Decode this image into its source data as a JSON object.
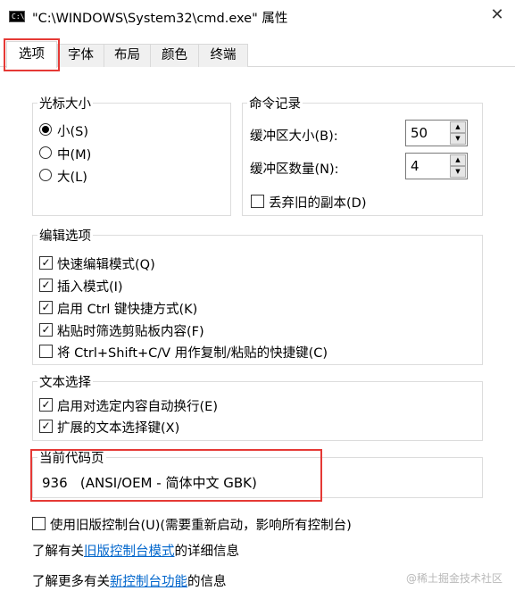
{
  "window": {
    "title": "\"C:\\WINDOWS\\System32\\cmd.exe\" 属性",
    "app_icon_text": "C:\\",
    "close_icon": "close-icon"
  },
  "tabs": [
    {
      "label": "选项",
      "active": true
    },
    {
      "label": "字体",
      "active": false
    },
    {
      "label": "布局",
      "active": false
    },
    {
      "label": "颜色",
      "active": false
    },
    {
      "label": "终端",
      "active": false
    }
  ],
  "cursor_size": {
    "title": "光标大小",
    "options": [
      {
        "label": "小(S)",
        "checked": true
      },
      {
        "label": "中(M)",
        "checked": false
      },
      {
        "label": "大(L)",
        "checked": false
      }
    ]
  },
  "command_history": {
    "title": "命令记录",
    "buffer_size_label": "缓冲区大小(B):",
    "buffer_size_value": "50",
    "buffer_count_label": "缓冲区数量(N):",
    "buffer_count_value": "4",
    "discard_label": "丢弃旧的副本(D)",
    "discard_checked": false
  },
  "edit_options": {
    "title": "编辑选项",
    "items": [
      {
        "label": "快速编辑模式(Q)",
        "checked": true
      },
      {
        "label": "插入模式(I)",
        "checked": true
      },
      {
        "label": "启用 Ctrl 键快捷方式(K)",
        "checked": true
      },
      {
        "label": "粘贴时筛选剪贴板内容(F)",
        "checked": true
      },
      {
        "label": "将 Ctrl+Shift+C/V 用作复制/粘贴的快捷键(C)",
        "checked": false
      }
    ]
  },
  "text_selection": {
    "title": "文本选择",
    "items": [
      {
        "label": "启用对选定内容自动换行(E)",
        "checked": true
      },
      {
        "label": "扩展的文本选择键(X)",
        "checked": true
      }
    ]
  },
  "code_page": {
    "title": "当前代码页",
    "value": "936   (ANSI/OEM - 简体中文 GBK)"
  },
  "legacy": {
    "label": "使用旧版控制台(U)(需要重新启动，影响所有控制台)",
    "checked": false
  },
  "learn_legacy": {
    "prefix": "了解有关",
    "link": "旧版控制台模式",
    "suffix": "的详细信息"
  },
  "learn_new": {
    "prefix": "了解更多有关",
    "link": "新控制台功能",
    "suffix": "的信息"
  },
  "watermark": "@稀土掘金技术社区",
  "colors": {
    "highlight": "#e53935",
    "link": "#0066cc"
  }
}
